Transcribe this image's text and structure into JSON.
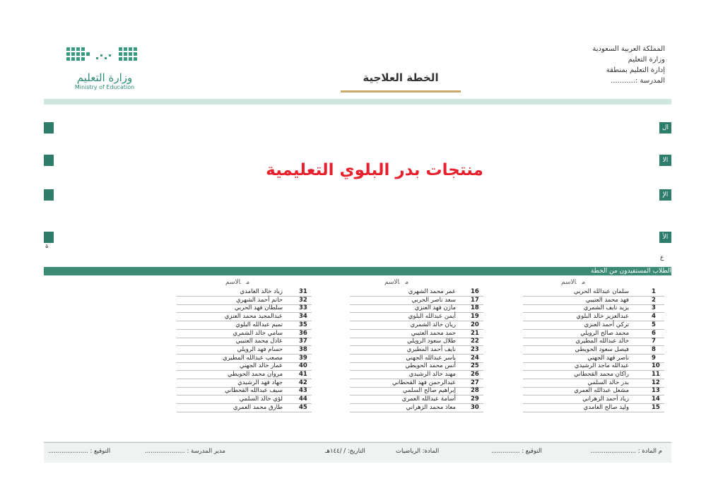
{
  "header": {
    "org_lines": [
      "المملكة العربية السعودية",
      "وزارة التعليم",
      "إدارة التعليم بمنطقة",
      "المدرسة :..........."
    ],
    "title": "الخطة العلاجية",
    "logo_ar": "وزارة التعليم",
    "logo_en": "Ministry of Education"
  },
  "watermark": "منتجات بدر البلوي التعليمية",
  "side_tabs": [
    "ال",
    "الا",
    "الإ",
    "الأ"
  ],
  "side_marks": {
    "left": "ة",
    "right": "ع"
  },
  "students": {
    "title": "الطلاب المستفيدون من الخطة",
    "col_num": "م",
    "col_name": "الاسم",
    "columns": [
      [
        {
          "n": "1",
          "name": "سلمان عبدالله الحربي"
        },
        {
          "n": "2",
          "name": "فهد محمد العتيبي"
        },
        {
          "n": "3",
          "name": "يزيد نايف الشمري"
        },
        {
          "n": "4",
          "name": "عبدالعزيز خالد البلوي"
        },
        {
          "n": "5",
          "name": "تركي أحمد العنزي"
        },
        {
          "n": "6",
          "name": "محمد صالح الرويلي"
        },
        {
          "n": "7",
          "name": "خالد عبدالله المطيري"
        },
        {
          "n": "8",
          "name": "فيصل سعود الحويطي"
        },
        {
          "n": "9",
          "name": "ناصر فهد الجهني"
        },
        {
          "n": "10",
          "name": "عبدالله ماجد الرشيدي"
        },
        {
          "n": "11",
          "name": "راكان محمد القحطاني"
        },
        {
          "n": "12",
          "name": "بدر خالد السلمي"
        },
        {
          "n": "13",
          "name": "مشعل عبدالله العمري"
        },
        {
          "n": "14",
          "name": "زياد أحمد الزهراني"
        },
        {
          "n": "15",
          "name": "وليد صالح الغامدي"
        }
      ],
      [
        {
          "n": "16",
          "name": "عمر محمد الشهري"
        },
        {
          "n": "17",
          "name": "سعد ناصر الحربي"
        },
        {
          "n": "18",
          "name": "مازن فهد العنزي"
        },
        {
          "n": "19",
          "name": "أيمن عبدالله البلوي"
        },
        {
          "n": "20",
          "name": "ريان خالد الشمري"
        },
        {
          "n": "21",
          "name": "حمد محمد العتيبي"
        },
        {
          "n": "22",
          "name": "طلال سعود الرويلي"
        },
        {
          "n": "23",
          "name": "نايف أحمد المطيري"
        },
        {
          "n": "24",
          "name": "ياسر عبدالله الجهني"
        },
        {
          "n": "25",
          "name": "أنس محمد الحويطي"
        },
        {
          "n": "26",
          "name": "مهند خالد الرشيدي"
        },
        {
          "n": "27",
          "name": "عبدالرحمن فهد القحطاني"
        },
        {
          "n": "28",
          "name": "إبراهيم صالح السلمي"
        },
        {
          "n": "29",
          "name": "أسامة عبدالله العمري"
        },
        {
          "n": "30",
          "name": "معاذ محمد الزهراني"
        }
      ],
      [
        {
          "n": "31",
          "name": "زياد خالد الغامدي"
        },
        {
          "n": "32",
          "name": "حاتم أحمد الشهري"
        },
        {
          "n": "33",
          "name": "سلطان فهد الحربي"
        },
        {
          "n": "34",
          "name": "عبدالمجيد محمد العنزي"
        },
        {
          "n": "35",
          "name": "تميم عبدالله البلوي"
        },
        {
          "n": "36",
          "name": "سامي خالد الشمري"
        },
        {
          "n": "37",
          "name": "عادل محمد العتيبي"
        },
        {
          "n": "38",
          "name": "حسام فهد الرويلي"
        },
        {
          "n": "39",
          "name": "مصعب عبدالله المطيري"
        },
        {
          "n": "40",
          "name": "عمار خالد الجهني"
        },
        {
          "n": "41",
          "name": "مروان محمد الحويطي"
        },
        {
          "n": "42",
          "name": "جهاد فهد الرشيدي"
        },
        {
          "n": "43",
          "name": "سيف عبدالله القحطاني"
        },
        {
          "n": "44",
          "name": "لؤي خالد السلمي"
        },
        {
          "n": "45",
          "name": "طارق محمد العمري"
        }
      ]
    ]
  },
  "footer": {
    "teacher": "م المادة : ........................",
    "teacher_sign": "التوقيع : ...............",
    "subject": "المادة: الرياضيات",
    "date": "التاريخ: / /١٤٤هـ",
    "principal": "مدير المدرسة : .....................",
    "principal_sign": "التوقيع : ....................."
  }
}
